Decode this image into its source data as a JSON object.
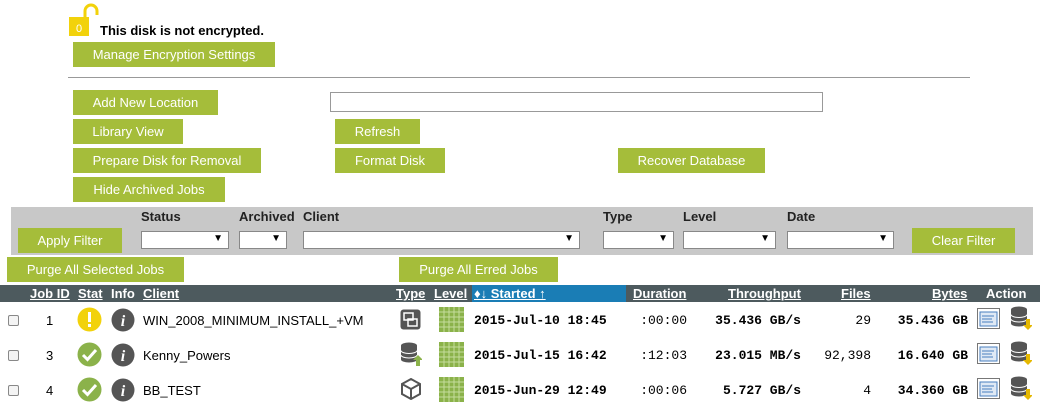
{
  "encryption": {
    "status_text": "This disk is not encrypted.",
    "manage_label": "Manage Encryption Settings",
    "lock_icon": "unlocked-padlock-icon"
  },
  "buttons": {
    "add_location": "Add New Location",
    "library_view": "Library View",
    "refresh": "Refresh",
    "prepare_disk": "Prepare Disk for Removal",
    "format_disk": "Format Disk",
    "recover_db": "Recover Database",
    "hide_archived": "Hide Archived Jobs"
  },
  "location_input": {
    "value": ""
  },
  "filters": {
    "apply": "Apply Filter",
    "clear": "Clear Filter",
    "labels": {
      "status": "Status",
      "archived": "Archived",
      "client": "Client",
      "type": "Type",
      "level": "Level",
      "date": "Date"
    },
    "arrow": "▼"
  },
  "purge": {
    "selected": "Purge All Selected Jobs",
    "erred": "Purge All Erred Jobs"
  },
  "table": {
    "headers": {
      "job_id": "Job ID",
      "stat": "Stat",
      "info": "Info",
      "client": "Client",
      "type": "Type",
      "level": "Level",
      "started": "♦↓ Started ↑",
      "duration": "Duration",
      "throughput": "Throughput",
      "files": "Files",
      "bytes": "Bytes",
      "action": "Action"
    },
    "rows": [
      {
        "id": "1",
        "stat_icon": "warning-icon",
        "client": "WIN_2008_MINIMUM_INSTALL_+VM",
        "type_icon": "vm-replication-icon",
        "started": "2015-Jul-10 18:45",
        "duration": ":00:00",
        "throughput": "35.436 GB/s",
        "files": "29",
        "bytes": "35.436 GB"
      },
      {
        "id": "3",
        "stat_icon": "success-icon",
        "client": "Kenny_Powers",
        "type_icon": "database-restore-icon",
        "started": "2015-Jul-15 16:42",
        "duration": ":12:03",
        "throughput": "23.015 MB/s",
        "files": "92,398",
        "bytes": "16.640 GB"
      },
      {
        "id": "4",
        "stat_icon": "success-icon",
        "client": "BB_TEST",
        "type_icon": "box-icon",
        "started": "2015-Jun-29 12:49",
        "duration": ":00:06",
        "throughput": "5.727 GB/s",
        "files": "4",
        "bytes": "34.360 GB"
      }
    ],
    "info_glyph": "i"
  },
  "colors": {
    "accent": "#a5bd3a",
    "header_bg": "#4d5a5e",
    "sorted_bg": "#1a7db5",
    "warning": "#f2d20b"
  }
}
